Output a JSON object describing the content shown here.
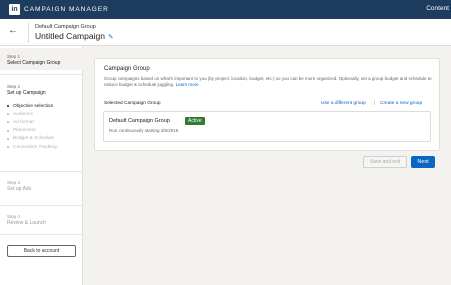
{
  "topbar": {
    "logo": "in",
    "brand": "CAMPAIGN MANAGER",
    "right_label": "Content"
  },
  "header": {
    "group_name": "Default Campaign Group",
    "campaign_title": "Untitled Campaign"
  },
  "sidebar": {
    "steps": [
      {
        "num": "Step 1",
        "title": "Select Campaign Group"
      },
      {
        "num": "Step 2",
        "title": "Set up Campaign"
      },
      {
        "num": "Step 3",
        "title": "Set up Ads"
      },
      {
        "num": "Step 4",
        "title": "Review & Launch"
      }
    ],
    "substeps": [
      "Objective selection",
      "Audience",
      "Ad format",
      "Placement",
      "Budget & Schedule",
      "Conversion Tracking"
    ],
    "back_button": "Back to account"
  },
  "card": {
    "title": "Campaign Group",
    "description": "Group campaigns based on what's important to you (by project, location, budget, etc.) so you can be more organized. Optionally, set a group budget and schedule to reduce budget & schedule juggling.",
    "learn_more": "Learn more",
    "selected_label": "Selected Campaign Group",
    "use_different": "Use a different group",
    "separator": "|",
    "create_new": "Create a new group",
    "selected_group": {
      "name": "Default Campaign Group",
      "status": "Active",
      "subtitle": "Run continuously starting 3/6/2019"
    }
  },
  "actions": {
    "save_exit": "Save and exit",
    "next": "Next"
  },
  "colors": {
    "topbar": "#1d3c5e",
    "accent": "#0a66c2",
    "active_badge": "#2e7d32"
  },
  "icons": [
    "linkedin-logo",
    "back-arrow-icon",
    "pencil-icon"
  ]
}
